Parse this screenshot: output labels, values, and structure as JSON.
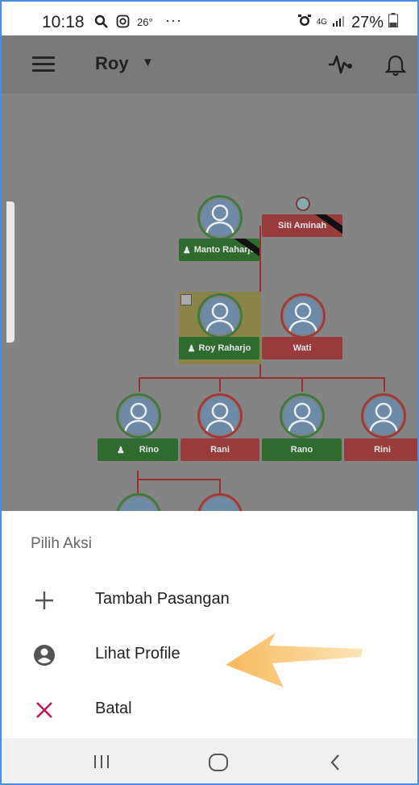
{
  "status_bar": {
    "time": "10:18",
    "temperature": "26°",
    "dots": "···",
    "network": "4G",
    "battery": "27%"
  },
  "app_bar": {
    "title": "Roy",
    "menu_icon": "hamburger-menu-icon",
    "activity_icon": "pulse-icon",
    "notification_icon": "bell-icon"
  },
  "tree": {
    "grandparents": [
      {
        "name": "Manto Raharjo",
        "gender": "male",
        "deceased": true
      },
      {
        "name": "Siti Aminah",
        "gender": "female",
        "deceased": true
      }
    ],
    "parents": [
      {
        "name": "Roy Raharjo",
        "gender": "male",
        "selected": true
      },
      {
        "name": "Wati",
        "gender": "female"
      }
    ],
    "children": [
      {
        "name": "Rino",
        "gender": "male"
      },
      {
        "name": "Rani",
        "gender": "female"
      },
      {
        "name": "Rano",
        "gender": "male"
      },
      {
        "name": "Rini",
        "gender": "female"
      }
    ]
  },
  "sheet": {
    "title": "Pilih Aksi",
    "actions": [
      {
        "label": "Tambah Pasangan",
        "icon": "plus-icon"
      },
      {
        "label": "Lihat Profile",
        "icon": "account-circle-icon"
      },
      {
        "label": "Batal",
        "icon": "close-icon"
      }
    ]
  },
  "colors": {
    "male": "#2f6b2f",
    "female": "#9a3b3b",
    "cancel_icon": "#c2185b",
    "arrow": "#f0a040"
  }
}
